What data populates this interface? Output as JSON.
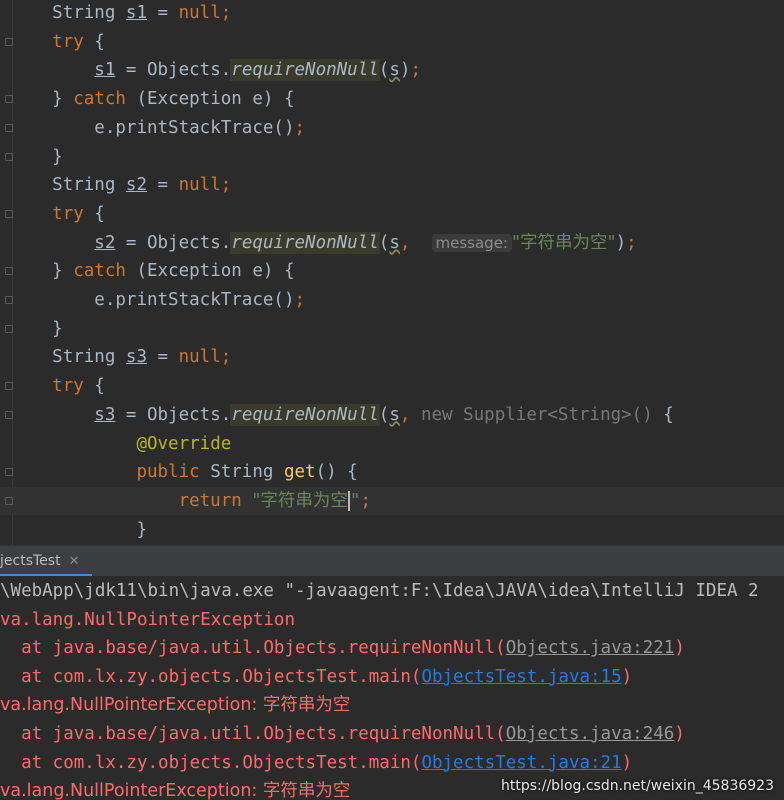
{
  "editor": {
    "lines": [
      {
        "indent": "    ",
        "segments": [
          [
            "t",
            "String "
          ],
          [
            "var",
            "s1"
          ],
          [
            "t",
            " = "
          ],
          [
            "kw",
            "null"
          ],
          [
            "kw",
            ";"
          ]
        ]
      },
      {
        "indent": "    ",
        "segments": [
          [
            "kw",
            "try"
          ],
          [
            "t",
            " {"
          ]
        ]
      },
      {
        "indent": "        ",
        "segments": [
          [
            "var",
            "s1"
          ],
          [
            "t",
            " = Objects."
          ],
          [
            "fn",
            "requireNonNull"
          ],
          [
            "t",
            "("
          ],
          [
            "squig",
            "s"
          ],
          [
            "t",
            ")"
          ],
          [
            "kw",
            ";"
          ]
        ]
      },
      {
        "indent": "    ",
        "segments": [
          [
            "t",
            "} "
          ],
          [
            "kw",
            "catch"
          ],
          [
            "t",
            " (Exception e) {"
          ]
        ]
      },
      {
        "indent": "        ",
        "segments": [
          [
            "t",
            "e.printStackTrace()"
          ],
          [
            "kw",
            ";"
          ]
        ]
      },
      {
        "indent": "    ",
        "segments": [
          [
            "t",
            "}"
          ]
        ]
      },
      {
        "indent": "    ",
        "segments": [
          [
            "t",
            "String "
          ],
          [
            "var",
            "s2"
          ],
          [
            "t",
            " = "
          ],
          [
            "kw",
            "null"
          ],
          [
            "kw",
            ";"
          ]
        ]
      },
      {
        "indent": "    ",
        "segments": [
          [
            "kw",
            "try"
          ],
          [
            "t",
            " {"
          ]
        ]
      },
      {
        "indent": "        ",
        "segments": [
          [
            "var",
            "s2"
          ],
          [
            "t",
            " = Objects."
          ],
          [
            "fn",
            "requireNonNull"
          ],
          [
            "t",
            "("
          ],
          [
            "squig",
            "s"
          ],
          [
            "kw",
            ", "
          ],
          [
            "t",
            " "
          ],
          [
            "hint",
            "message:"
          ],
          [
            "str",
            "\"字符串为空\""
          ],
          [
            "t",
            ")"
          ],
          [
            "kw",
            ";"
          ]
        ]
      },
      {
        "indent": "    ",
        "segments": [
          [
            "t",
            "} "
          ],
          [
            "kw",
            "catch"
          ],
          [
            "t",
            " (Exception e) {"
          ]
        ]
      },
      {
        "indent": "        ",
        "segments": [
          [
            "t",
            "e.printStackTrace()"
          ],
          [
            "kw",
            ";"
          ]
        ]
      },
      {
        "indent": "    ",
        "segments": [
          [
            "t",
            "}"
          ]
        ]
      },
      {
        "indent": "    ",
        "segments": [
          [
            "t",
            "String "
          ],
          [
            "var",
            "s3"
          ],
          [
            "t",
            " = "
          ],
          [
            "kw",
            "null"
          ],
          [
            "kw",
            ";"
          ]
        ]
      },
      {
        "indent": "    ",
        "segments": [
          [
            "kw",
            "try"
          ],
          [
            "t",
            " {"
          ]
        ]
      },
      {
        "indent": "        ",
        "segments": [
          [
            "var",
            "s3"
          ],
          [
            "t",
            " = Objects."
          ],
          [
            "fn",
            "requireNonNull"
          ],
          [
            "t",
            "("
          ],
          [
            "squig",
            "s"
          ],
          [
            "kw",
            ", "
          ],
          [
            "gray",
            "new Supplier<String>() "
          ],
          [
            "t",
            "{"
          ]
        ]
      },
      {
        "indent": "            ",
        "segments": [
          [
            "ann",
            "@Override"
          ]
        ]
      },
      {
        "indent": "            ",
        "segments": [
          [
            "kw",
            "public "
          ],
          [
            "t",
            "String "
          ],
          [
            "method",
            "get"
          ],
          [
            "t",
            "() {"
          ]
        ]
      },
      {
        "indent": "                ",
        "segments": [
          [
            "kw",
            "return "
          ],
          [
            "str",
            "\"字符串为空"
          ],
          [
            "caret",
            ""
          ],
          [
            "str",
            "\""
          ],
          [
            "kw",
            ";"
          ]
        ]
      },
      {
        "indent": "            ",
        "segments": [
          [
            "t",
            "}"
          ]
        ]
      }
    ]
  },
  "run_tab": {
    "label": "jectsTest"
  },
  "console": {
    "lines": [
      {
        "segments": [
          [
            "white",
            "\\WebApp\\jdk11\\bin\\java.exe \"-javaagent:F:\\Idea\\JAVA\\idea\\IntelliJ IDEA 2"
          ]
        ]
      },
      {
        "segments": [
          [
            "red",
            "va.lang.NullPointerException"
          ]
        ]
      },
      {
        "segments": [
          [
            "red",
            "  at java.base/java.util.Objects.requireNonNull("
          ],
          [
            "glink",
            "Objects.java:221"
          ],
          [
            "red",
            ")"
          ]
        ]
      },
      {
        "segments": [
          [
            "red",
            "  at com.lx.zy.objects.ObjectsTest.main("
          ],
          [
            "link",
            "ObjectsTest.java:15"
          ],
          [
            "red",
            ")"
          ]
        ]
      },
      {
        "segments": [
          [
            "red",
            "va.lang.NullPointerException: 字符串为空"
          ]
        ]
      },
      {
        "segments": [
          [
            "red",
            "  at java.base/java.util.Objects.requireNonNull("
          ],
          [
            "glink",
            "Objects.java:246"
          ],
          [
            "red",
            ")"
          ]
        ]
      },
      {
        "segments": [
          [
            "red",
            "  at com.lx.zy.objects.ObjectsTest.main("
          ],
          [
            "link",
            "ObjectsTest.java:21"
          ],
          [
            "red",
            ")"
          ]
        ]
      },
      {
        "segments": [
          [
            "red",
            "va.lang.NullPointerException: 字符串为空"
          ]
        ]
      }
    ]
  },
  "watermark": "https://blog.csdn.net/weixin_45836923",
  "colors": {
    "background": "#2b2b2b",
    "keyword": "#cc7832",
    "string": "#6a8759",
    "error": "#ff6b68",
    "link": "#287bde"
  }
}
